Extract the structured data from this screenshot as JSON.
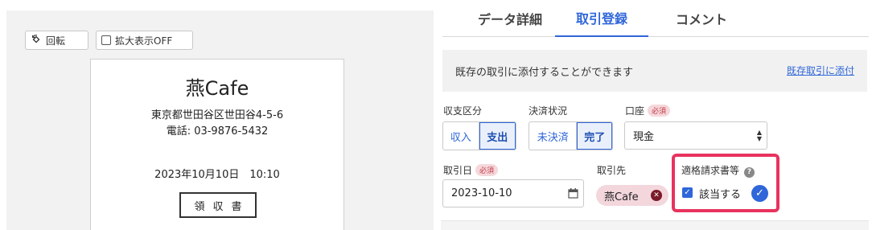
{
  "viewer": {
    "rotate_label": "回転",
    "zoom_label": "拡大表示OFF"
  },
  "receipt": {
    "shop_name": "燕Cafe",
    "address": "東京都世田谷区世田谷4-5-6",
    "phone": "電話: 03-9876-5432",
    "datetime": "2023年10月10日　10:10",
    "stamp": "領収書"
  },
  "tabs": [
    {
      "label": "データ詳細"
    },
    {
      "label": "取引登録"
    },
    {
      "label": "コメント"
    }
  ],
  "info": {
    "text": "既存の取引に添付することができます",
    "link": "既存取引に添付"
  },
  "form": {
    "income_type_label": "収支区分",
    "income_option": "収入",
    "expense_option": "支出",
    "settlement_label": "決済状況",
    "unsettled_option": "未決済",
    "settled_option": "完了",
    "account_label": "口座",
    "required_badge": "必須",
    "account_value": "現金",
    "date_label": "取引日",
    "date_value": "2023-10-10",
    "partner_label": "取引先",
    "partner_tag": "燕Cafe",
    "invoice_label": "適格請求書等",
    "invoice_checkbox_label": "該当する"
  }
}
